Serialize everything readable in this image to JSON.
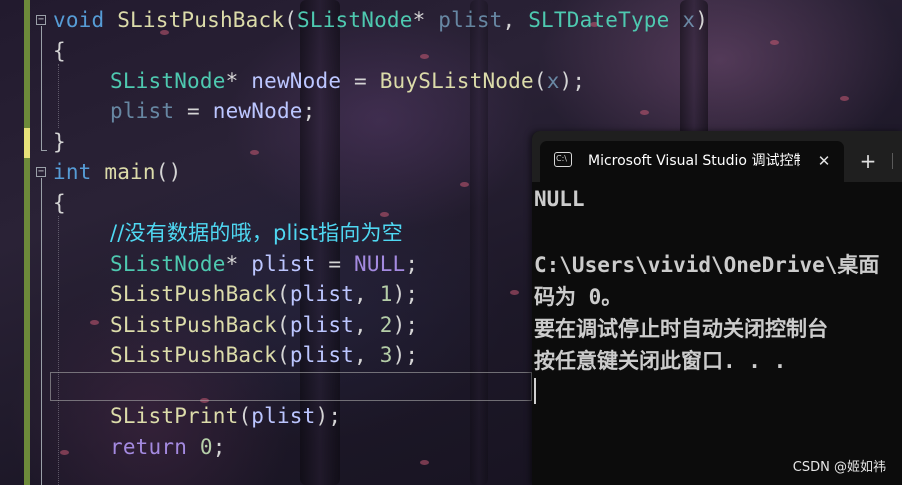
{
  "editor": {
    "lines": {
      "l1": {
        "kw": "void",
        "fn": "SListPushBack",
        "open": "(",
        "t1": "SListNode",
        "star": "*",
        "p1": " plist",
        "comma": ", ",
        "t2": "SLTDateType",
        "p2": " x",
        "close": ")"
      },
      "l2": {
        "text": "{"
      },
      "l3": {
        "t": "SListNode",
        "star": "*",
        "v": " newNode",
        "eq": " = ",
        "fn": "BuySListNode",
        "open": "(",
        "arg": "x",
        "close": ");"
      },
      "l4": {
        "v": "plist",
        "eq": " = ",
        "v2": "newNode",
        "end": ";"
      },
      "l5": {
        "text": "}"
      },
      "l6": {
        "kw": "int",
        "fn": " main",
        "paren": "()"
      },
      "l7": {
        "text": "{"
      },
      "l8": {
        "comment": "//没有数据的哦，plist指向为空"
      },
      "l9": {
        "t": "SListNode",
        "star": "*",
        "v": " plist",
        "eq": " = ",
        "null": "NULL",
        "end": ";"
      },
      "l10": {
        "fn": "SListPushBack",
        "open": "(",
        "v": "plist",
        "comma": ", ",
        "num": "1",
        "close": ");"
      },
      "l11": {
        "fn": "SListPushBack",
        "open": "(",
        "v": "plist",
        "comma": ", ",
        "num": "2",
        "close": ");"
      },
      "l12": {
        "fn": "SListPushBack",
        "open": "(",
        "v": "plist",
        "comma": ", ",
        "num": "3",
        "close": ");"
      },
      "l14": {
        "fn": "SListPrint",
        "open": "(",
        "v": "plist",
        "close": ");"
      },
      "l15": {
        "kw": "return",
        "num": " 0",
        "end": ";"
      }
    }
  },
  "terminal": {
    "tab_title": "Microsoft Visual Studio 调试控制台",
    "close_glyph": "✕",
    "new_tab_glyph": "+",
    "icon_label": "C:\\",
    "output": [
      "NULL",
      "",
      "C:\\Users\\vivid\\OneDrive\\桌面",
      "码为 0。",
      "要在调试停止时自动关闭控制台",
      "按任意键关闭此窗口. . ."
    ]
  },
  "watermark": "CSDN @姬如祎",
  "colors": {
    "keyword": "#569cd6",
    "type": "#4ec9b0",
    "comment": "#4fd8f2",
    "gutter_changed": "#6d8a3a",
    "gutter_modified": "#e8e27a",
    "terminal_bg": "#0c0c0c"
  }
}
